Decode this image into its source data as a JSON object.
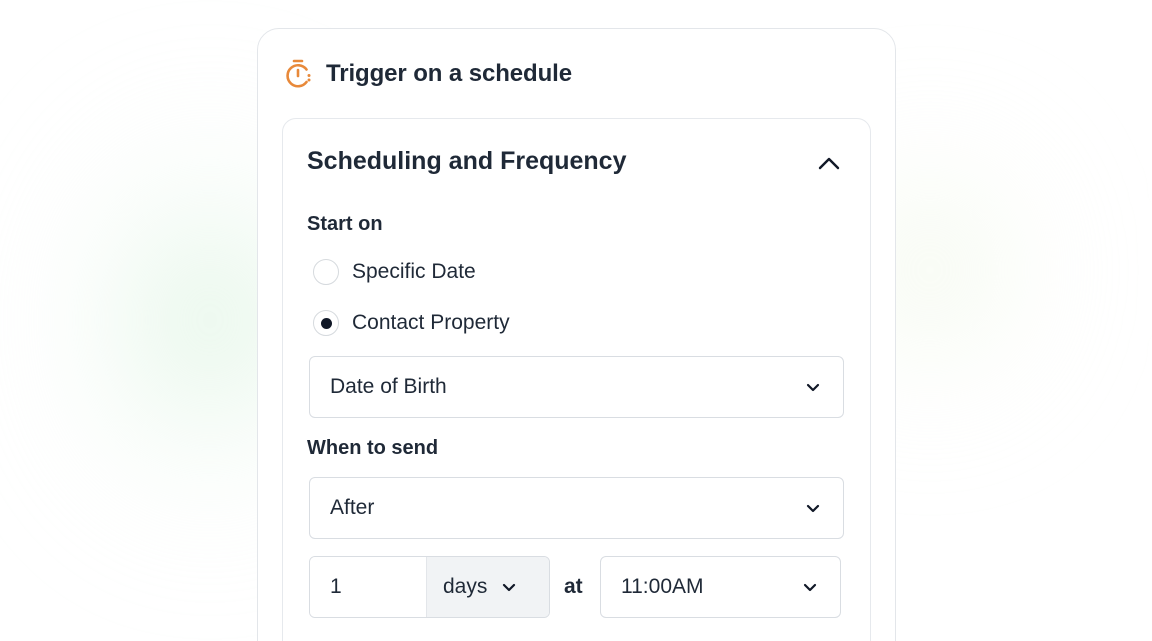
{
  "trigger": {
    "title": "Trigger on a schedule",
    "icon": "stopwatch-icon",
    "icon_color": "#e8893a"
  },
  "scheduling": {
    "title": "Scheduling and Frequency",
    "expanded": true,
    "start_on": {
      "label": "Start on",
      "options": [
        {
          "label": "Specific Date",
          "selected": false
        },
        {
          "label": "Contact Property",
          "selected": true
        }
      ],
      "property_select": {
        "value": "Date of Birth"
      }
    },
    "when_to_send": {
      "label": "When to send",
      "relation_select": {
        "value": "After"
      },
      "offset": {
        "value": "1",
        "unit": "days"
      },
      "at_label": "at",
      "time_select": {
        "value": "11:00AM"
      }
    }
  },
  "colors": {
    "accent": "#e8893a",
    "text": "#1f2937",
    "border": "#d9dde2"
  }
}
